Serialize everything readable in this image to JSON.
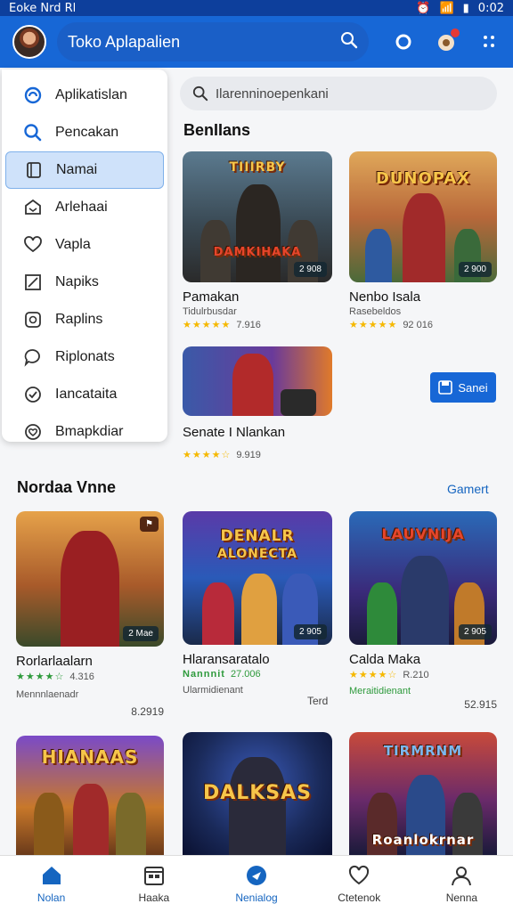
{
  "status_bar": {
    "left_text": "Eoke Nrd Rl",
    "time": "0:02"
  },
  "app_bar": {
    "title": "Toko Aplapalien"
  },
  "drawer": {
    "items": [
      {
        "label": "Aplikatislan",
        "icon": "apps-icon",
        "active": false
      },
      {
        "label": "Pencakan",
        "icon": "search-icon",
        "active": false
      },
      {
        "label": "Namai",
        "icon": "library-icon",
        "active": true
      },
      {
        "label": "Arlehaai",
        "icon": "inbox-icon",
        "active": false
      },
      {
        "label": "Vapla",
        "icon": "heart-icon",
        "active": false
      },
      {
        "label": "Napiks",
        "icon": "edit-icon",
        "active": false
      },
      {
        "label": "Raplins",
        "icon": "refresh-icon",
        "active": false
      },
      {
        "label": "Riplonats",
        "icon": "chat-icon",
        "active": false
      },
      {
        "label": "Iancataita",
        "icon": "check-circle-icon",
        "active": false
      },
      {
        "label": "Bmapkdiar",
        "icon": "heart-check-icon",
        "active": false
      }
    ]
  },
  "search": {
    "placeholder": "Ilarenninoepenkani"
  },
  "section1": {
    "title": "BenIIans",
    "cards": [
      {
        "name": "Pamakan",
        "sub": "Tidulrbusdar",
        "rating": "7.916",
        "badge": "2 908",
        "logo_top": "TIIIRBY",
        "logo_bottom": "DAMKIHAKA",
        "stars": "★★★★★"
      },
      {
        "name": "Nenbo Isala",
        "sub": "Rasebeldos",
        "rating": "92 016",
        "badge": "2 900",
        "logo_top": "DUNOPAX",
        "logo_bottom": "",
        "stars": "★★★★★"
      },
      {
        "name": "Senate I Nlankan",
        "sub": "",
        "rating": "9.919",
        "badge": "",
        "logo_top": "",
        "logo_bottom": "",
        "stars": "★★★★☆"
      }
    ],
    "save_button": "Sanei"
  },
  "section2": {
    "title": "Nordaa Vnne",
    "see_all": "Gamert",
    "cards": [
      {
        "name": "Rorlarlaalarn",
        "sub": "Mennnlaenadr",
        "rating": "4.316",
        "extra": "8.2919",
        "badge": "2 Mae",
        "stars": "★★★★☆",
        "green": true
      },
      {
        "name": "Hlaransaratalo",
        "sub": "Ularmidienant",
        "rating": "27.006",
        "extra": "Terd",
        "badge": "2 905",
        "logo_top": "DENALR",
        "logo_bottom": "ALONECTA",
        "stars": "Nannnit",
        "green": true
      },
      {
        "name": "Calda Maka",
        "sub": "Meraitidienant",
        "rating": "R.210",
        "extra": "52.915",
        "badge": "2 905",
        "logo_top": "LAUVNIJA",
        "logo_bottom": "",
        "stars": "★★★★☆",
        "green": false
      }
    ]
  },
  "section3": {
    "cards": [
      {
        "logo_top": "HIANAAS",
        "logo_bottom": ""
      },
      {
        "logo_top": "DALKSAS",
        "logo_bottom": ""
      },
      {
        "logo_top": "TIRMRNM",
        "logo_bottom": "Roanlokrnar"
      }
    ]
  },
  "bottom_nav": {
    "items": [
      {
        "label": "Nolan",
        "icon": "home-icon",
        "active": true
      },
      {
        "label": "Haaka",
        "icon": "calendar-icon",
        "active": false
      },
      {
        "label": "Nenialog",
        "icon": "compass-icon",
        "active": true
      },
      {
        "label": "Ctetenok",
        "icon": "heart-icon",
        "active": false
      },
      {
        "label": "Nenna",
        "icon": "person-icon",
        "active": false
      }
    ]
  },
  "colors": {
    "primary": "#1767d6",
    "accent": "#1565c0",
    "star": "#f5b800",
    "star_green": "#2e9a3c"
  }
}
